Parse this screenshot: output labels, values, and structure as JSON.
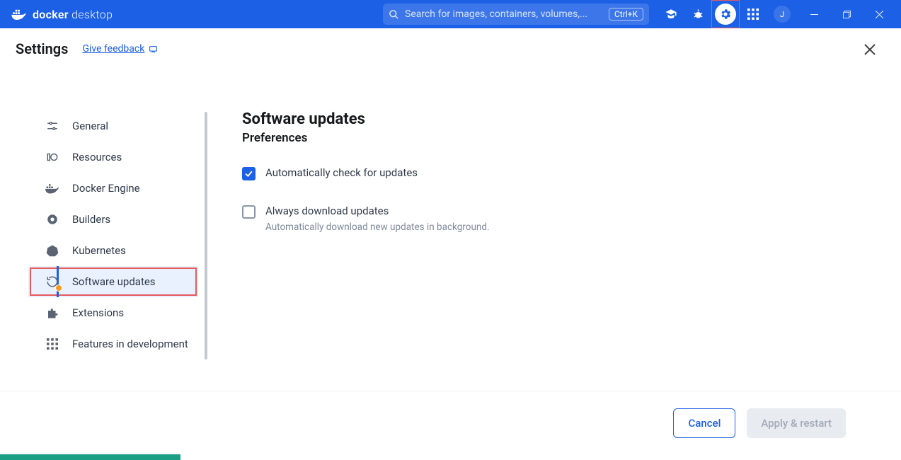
{
  "app": {
    "name_bold": "docker",
    "name_thin": " desktop"
  },
  "search": {
    "placeholder": "Search for images, containers, volumes,...",
    "shortcut": "Ctrl+K"
  },
  "avatar": {
    "initial": "J"
  },
  "header": {
    "title": "Settings",
    "feedback": "Give feedback"
  },
  "sidebar": {
    "items": [
      {
        "label": "General"
      },
      {
        "label": "Resources"
      },
      {
        "label": "Docker Engine"
      },
      {
        "label": "Builders"
      },
      {
        "label": "Kubernetes"
      },
      {
        "label": "Software updates"
      },
      {
        "label": "Extensions"
      },
      {
        "label": "Features in development"
      }
    ]
  },
  "main": {
    "title": "Software updates",
    "subtitle": "Preferences",
    "opt1": {
      "label": "Automatically check for updates",
      "checked": true
    },
    "opt2": {
      "label": "Always download updates",
      "checked": false,
      "desc": "Automatically download new updates in background."
    }
  },
  "footer": {
    "cancel": "Cancel",
    "apply": "Apply & restart"
  }
}
